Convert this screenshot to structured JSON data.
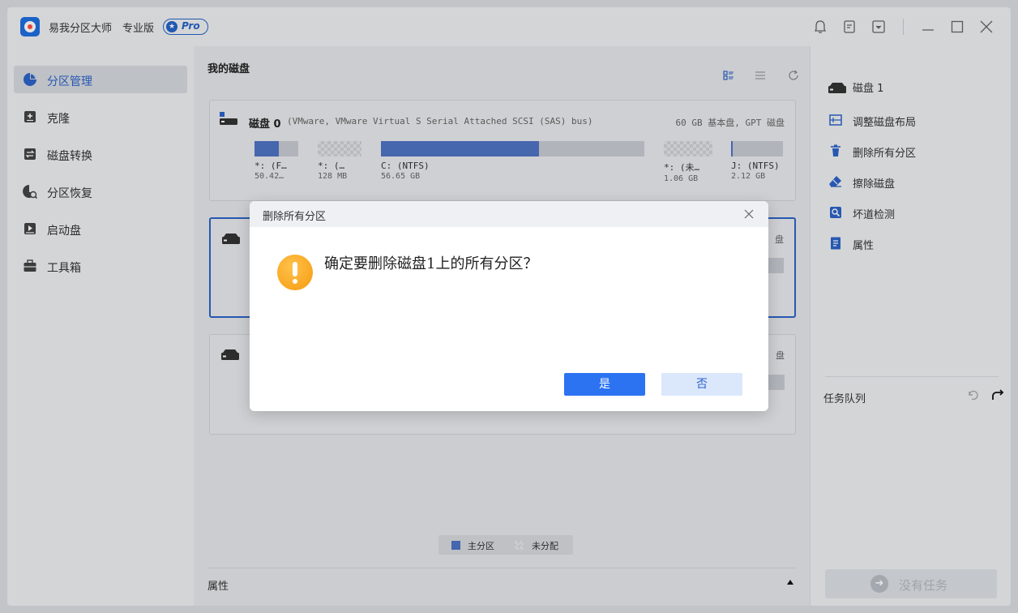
{
  "app": {
    "title": "易我分区大师",
    "edition": "专业版",
    "badge": "Pro"
  },
  "sidebar": {
    "items": [
      {
        "label": "分区管理",
        "icon": "pie-chart-icon",
        "active": true
      },
      {
        "label": "克隆",
        "icon": "clone-icon"
      },
      {
        "label": "磁盘转换",
        "icon": "convert-icon"
      },
      {
        "label": "分区恢复",
        "icon": "recovery-icon"
      },
      {
        "label": "启动盘",
        "icon": "boot-disk-icon"
      },
      {
        "label": "工具箱",
        "icon": "toolbox-icon"
      }
    ]
  },
  "main": {
    "title": "我的磁盘",
    "disk0": {
      "name": "磁盘 0",
      "desc": "(VMware,  VMware Virtual S Serial Attached SCSI (SAS) bus)",
      "meta": "60 GB 基本盘, GPT 磁盘",
      "partitions": [
        {
          "label": "*: (F…",
          "size": "50.42…",
          "used": 0.55,
          "type": "primary"
        },
        {
          "label": "*: (…",
          "size": "128 MB",
          "used": 0,
          "type": "unallocated"
        },
        {
          "label": "C: (NTFS)",
          "size": "56.65 GB",
          "used": 0.6,
          "type": "primary"
        },
        {
          "label": "*: (未…",
          "size": "1.06 GB",
          "used": 0,
          "type": "unallocated"
        },
        {
          "label": "J: (NTFS)",
          "size": "2.12 GB",
          "used": 0.02,
          "type": "primary"
        }
      ]
    },
    "disk1_meta_fragment": "盘",
    "disk2_meta_fragment": "盘",
    "legend": {
      "primary": "主分区",
      "unallocated": "未分配"
    },
    "properties_label": "属性"
  },
  "right_panel": {
    "disk_label": "磁盘 1",
    "actions": [
      {
        "label": "调整磁盘布局",
        "icon": "layout-icon"
      },
      {
        "label": "删除所有分区",
        "icon": "trash-icon"
      },
      {
        "label": "擦除磁盘",
        "icon": "eraser-icon"
      },
      {
        "label": "坏道检测",
        "icon": "scan-icon"
      },
      {
        "label": "属性",
        "icon": "properties-icon"
      }
    ],
    "queue_title": "任务队列",
    "no_task": "没有任务"
  },
  "dialog": {
    "title": "删除所有分区",
    "message": "确定要删除磁盘1上的所有分区？",
    "yes": "是",
    "no": "否"
  },
  "colors": {
    "accent": "#2c73f2",
    "primary_partition": "#4f73c4",
    "warning": "#f59a10"
  }
}
